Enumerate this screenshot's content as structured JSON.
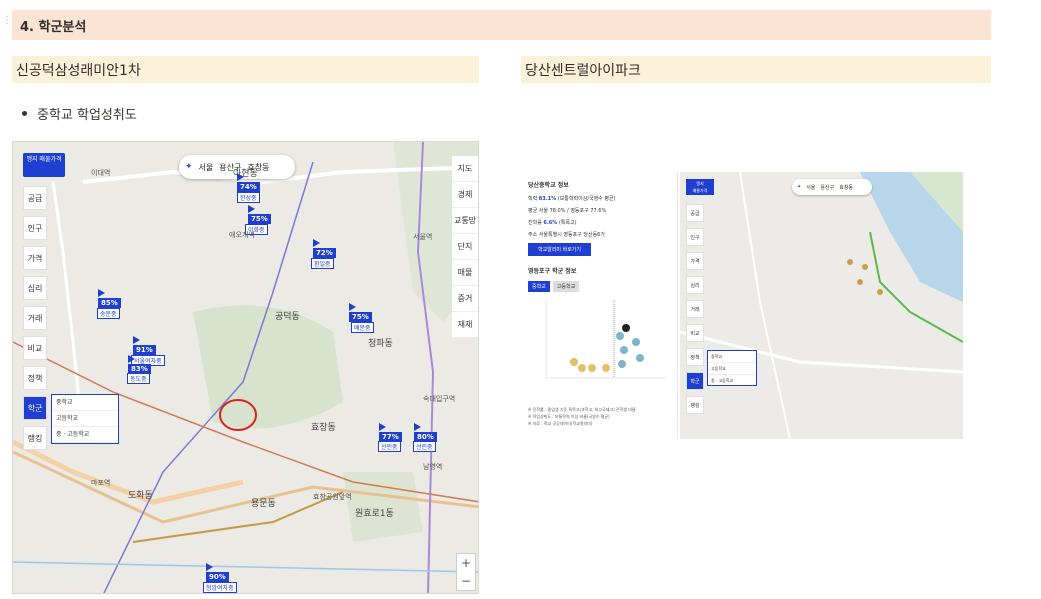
{
  "section": {
    "title": "4. 학군분석"
  },
  "columns": {
    "left_title": "신공덕삼성래미안1차",
    "right_title": "당산센트럴아이파크"
  },
  "bullet": {
    "text": "중학교 학업성취도"
  },
  "map_left": {
    "brand": "맹지 매물가격",
    "location": {
      "city": "서울",
      "district": "용산구",
      "dong": "효창동"
    },
    "side_menu": [
      "공급",
      "인구",
      "가격",
      "심리",
      "거래",
      "비교",
      "정책",
      "학군",
      "랭킹"
    ],
    "right_menu": [
      "지도",
      "경제",
      "교통망",
      "단지",
      "매물",
      "증거",
      "재재"
    ],
    "school_popup": [
      "중학교",
      "고등학교",
      "중 · 고등학교"
    ],
    "percent_markers": [
      {
        "value": "74%",
        "label": "한성중"
      },
      {
        "value": "75%",
        "label": "이화중"
      },
      {
        "value": "72%",
        "label": "환일중"
      },
      {
        "value": "85%",
        "label": "숭문중"
      },
      {
        "value": "75%",
        "label": "배문중"
      },
      {
        "value": "91%",
        "label": "서울여자중"
      },
      {
        "value": "83%",
        "label": "동도중"
      },
      {
        "value": "77%",
        "label": "선린중"
      },
      {
        "value": "80%",
        "label": "선린중"
      },
      {
        "value": "90%",
        "label": "청암여자중"
      }
    ],
    "places": [
      "아현동",
      "이대역",
      "공덕동",
      "청파동",
      "효창동",
      "도화동",
      "용문동",
      "원효로1동",
      "마포역",
      "효창공원앞역",
      "숙대입구역",
      "남영역",
      "애오개역",
      "서울역"
    ],
    "zoom": {
      "plus": "+",
      "minus": "−"
    }
  },
  "right_panel": {
    "title": "당산중학교 정보",
    "rows": [
      {
        "label": "학력",
        "value": "83.1%",
        "extra": "(보통학력이상/국영수 평균)"
      },
      {
        "label": "평균",
        "value": "",
        "extra": "서울 78.0% / 영등포구 77.6%"
      },
      {
        "label": "진학률",
        "value": "6.6%",
        "extra": "(특목고)"
      },
      {
        "label": "주소",
        "value": "",
        "extra": "서울특별시 영등포구 당산동6가"
      }
    ],
    "link_button": "학교알리미 바로가기",
    "sub_title": "영등포구 학군 정보",
    "tabs": [
      "중학교",
      "고등학교"
    ],
    "notes": [
      "※ 진학률 : 졸업생 기준 특목고(과학고, 외고국제고) 진학생 비율",
      "※ 학업성취도 : 보통학력 이상 비율(국영수 평균)",
      "※ 자료 : 학교 공공데이터(학교알리미)"
    ],
    "map_location": {
      "city": "서울",
      "district": "용산구",
      "dong": "효창동"
    },
    "map_menu": [
      "공급",
      "인구",
      "가격",
      "심리",
      "거래",
      "비교",
      "정책",
      "학군",
      "랭킹"
    ],
    "map_popup": [
      "중학교",
      "고등학교",
      "중 · 고등학교"
    ]
  }
}
